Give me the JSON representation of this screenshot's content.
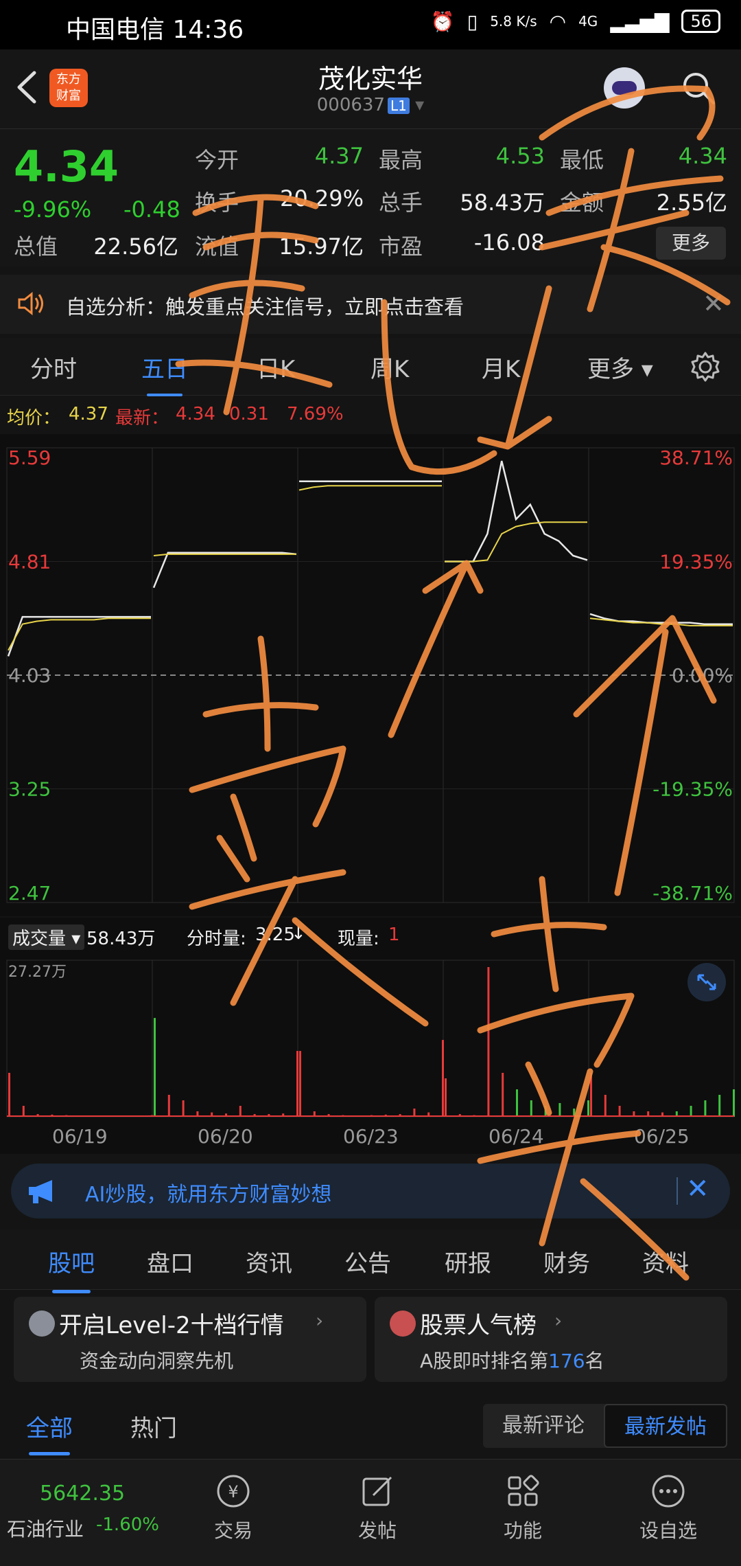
{
  "status_bar": {
    "carrier": "中国电信",
    "time": "14:36",
    "net_speed": "5.8 K/s",
    "network": "4G",
    "battery": "56"
  },
  "header": {
    "logo_text": "东方\n财富",
    "stock_name": "茂化实华",
    "stock_code": "000637",
    "level_badge": "L1"
  },
  "quote": {
    "price": "4.34",
    "change_pct": "-9.96%",
    "change_amt": "-0.48",
    "total_value_label": "总值",
    "total_value": "22.56亿",
    "open_label": "今开",
    "open": "4.37",
    "high_label": "最高",
    "high": "4.53",
    "low_label": "最低",
    "low": "4.34",
    "turnover_label": "换手",
    "turnover": "20.29%",
    "volume_label": "总手",
    "volume": "58.43万",
    "amount_label": "金额",
    "amount": "2.55亿",
    "float_label": "流值",
    "float_value": "15.97亿",
    "pe_label": "市盈",
    "pe": "-16.08",
    "more_label": "更多"
  },
  "banner": {
    "text": "自选分析：触发重点关注信号，立即点击查看"
  },
  "chart_tabs": [
    "分时",
    "五日",
    "日K",
    "周K",
    "月K",
    "更多"
  ],
  "chart_tabs_active": 1,
  "info_row": {
    "avg_label": "均价：",
    "avg": "4.37",
    "latest_label": "最新：",
    "latest": "4.34",
    "change": "0.31",
    "change_pct": "7.69%"
  },
  "volume_header": {
    "label": "成交量",
    "value": "58.43万",
    "tick_label": "分时量:",
    "tick_value": "3.25",
    "now_label": "现量:",
    "now_value": "1",
    "max_label": "27.27万"
  },
  "chart_data": {
    "type": "line",
    "title": "",
    "x": [
      "06/19",
      "06/20",
      "06/23",
      "06/24",
      "06/25"
    ],
    "y_ticks_left": [
      "5.59",
      "4.81",
      "4.03",
      "3.25",
      "2.47"
    ],
    "y_ticks_right": [
      "38.71%",
      "19.35%",
      "0.00%",
      "-19.35%",
      "-38.71%"
    ],
    "ylim": [
      2.47,
      5.59
    ],
    "reference_price": 4.03,
    "series": [
      {
        "name": "price",
        "color": "#e8e8e8",
        "days": [
          [
            4.16,
            4.43,
            4.43,
            4.43,
            4.43,
            4.43,
            4.43,
            4.43,
            4.43,
            4.43,
            4.43
          ],
          [
            4.63,
            4.87,
            4.87,
            4.87,
            4.87,
            4.87,
            4.87,
            4.87,
            4.87,
            4.87,
            4.86
          ],
          [
            5.36,
            5.36,
            5.36,
            5.36,
            5.36,
            5.36,
            5.36,
            5.36,
            5.36,
            5.36,
            5.36
          ],
          [
            4.81,
            4.81,
            4.81,
            5.0,
            5.5,
            5.1,
            5.2,
            5.0,
            4.95,
            4.85,
            4.82
          ],
          [
            4.45,
            4.42,
            4.4,
            4.4,
            4.39,
            4.39,
            4.39,
            4.39,
            4.38,
            4.38,
            4.38
          ]
        ]
      },
      {
        "name": "avg",
        "color": "#e8d44a",
        "days": [
          [
            4.2,
            4.38,
            4.4,
            4.41,
            4.41,
            4.41,
            4.41,
            4.42,
            4.42,
            4.42,
            4.42
          ],
          [
            4.85,
            4.86,
            4.86,
            4.86,
            4.86,
            4.86,
            4.86,
            4.86,
            4.86,
            4.86,
            4.86
          ],
          [
            5.3,
            5.32,
            5.33,
            5.33,
            5.33,
            5.33,
            5.33,
            5.33,
            5.33,
            5.33,
            5.33
          ],
          [
            4.81,
            4.81,
            4.81,
            4.82,
            5.0,
            5.05,
            5.07,
            5.08,
            5.08,
            5.08,
            5.08
          ],
          [
            4.42,
            4.41,
            4.4,
            4.39,
            4.39,
            4.38,
            4.38,
            4.37,
            4.37,
            4.37,
            4.37
          ]
        ]
      }
    ],
    "volume": {
      "max": 27.27,
      "unit": "万",
      "days": [
        [
          8,
          2,
          0.5,
          0.4,
          0.3,
          0.2,
          0.2,
          0.2,
          0.2,
          0.2,
          0.3
        ],
        [
          18,
          4,
          3,
          1,
          0.8,
          0.6,
          2,
          0.5,
          0.5,
          0.6,
          12
        ],
        [
          12,
          1,
          0.5,
          0.3,
          0.2,
          0.3,
          0.4,
          0.5,
          1.5,
          0.8,
          14
        ],
        [
          7,
          0.5,
          0.3,
          27.27,
          8,
          5,
          3,
          2,
          2.5,
          1.5,
          3
        ],
        [
          8,
          4,
          2,
          1,
          1,
          0.8,
          1,
          2,
          3,
          4,
          5
        ]
      ]
    }
  },
  "ai_banner": {
    "text": "AI炒股，就用东方财富妙想"
  },
  "info_tabs": [
    "股吧",
    "盘口",
    "资讯",
    "公告",
    "研报",
    "财务",
    "资料"
  ],
  "info_tabs_active": 0,
  "cards": [
    {
      "title": "开启Level-2十档行情",
      "sub": "资金动向洞察先机"
    },
    {
      "title": "股票人气榜",
      "sub_prefix": "A股即时排名第",
      "rank": "176",
      "sub_suffix": "名"
    }
  ],
  "comment_tabs": [
    "全部",
    "热门"
  ],
  "comment_tabs_active": 0,
  "sort_buttons": [
    "最新评论",
    "最新发帖"
  ],
  "sort_active": 1,
  "bottom_nav": {
    "index_value": "5642.35",
    "index_name": "石油行业",
    "index_change": "-1.60%",
    "items": [
      "交易",
      "发帖",
      "功能",
      "设自选"
    ]
  },
  "colors": {
    "up": "#e83a3a",
    "down": "#3fc33f",
    "accent": "#3f8cff",
    "annotation": "#f28c40"
  }
}
